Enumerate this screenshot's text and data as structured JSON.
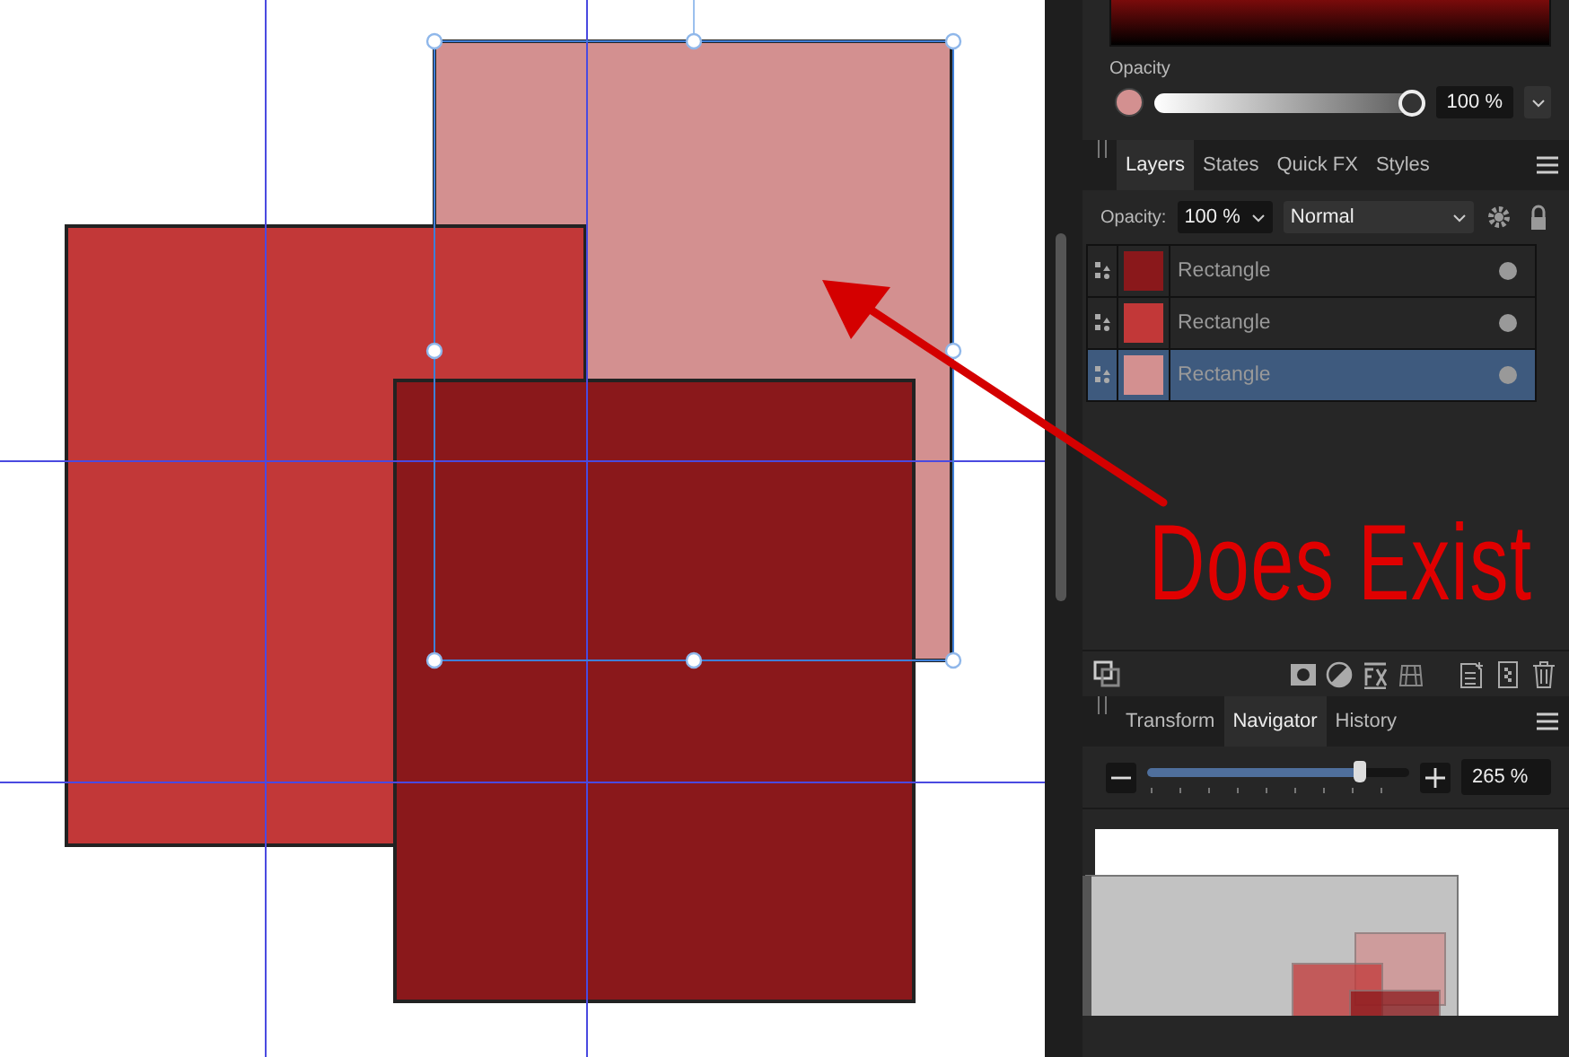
{
  "color_panel": {
    "opacity_label": "Opacity",
    "opacity": {
      "level": 1,
      "value": "100 %"
    }
  },
  "layers_panel": {
    "tabs": [
      {
        "label": "Layers",
        "selected": true
      },
      {
        "label": "States",
        "selected": false
      },
      {
        "label": "Quick FX",
        "selected": false
      },
      {
        "label": "Styles",
        "selected": false
      }
    ],
    "opacity_label": "Opacity:",
    "opacity_value": "100 %",
    "blend_mode": "Normal",
    "layers": [
      {
        "name": "Rectangle",
        "color": "#8a181b",
        "selected": false
      },
      {
        "name": "Rectangle",
        "color": "#c23838",
        "selected": false
      },
      {
        "name": "Rectangle",
        "color": "#d39090",
        "selected": true
      }
    ]
  },
  "navigator_panel": {
    "tabs": [
      {
        "label": "Transform",
        "selected": false
      },
      {
        "label": "Navigator",
        "selected": true
      },
      {
        "label": "History",
        "selected": false
      }
    ],
    "zoom": {
      "level": 0.83,
      "value": "265 %"
    }
  },
  "annotation": {
    "text": "Does Exist"
  }
}
